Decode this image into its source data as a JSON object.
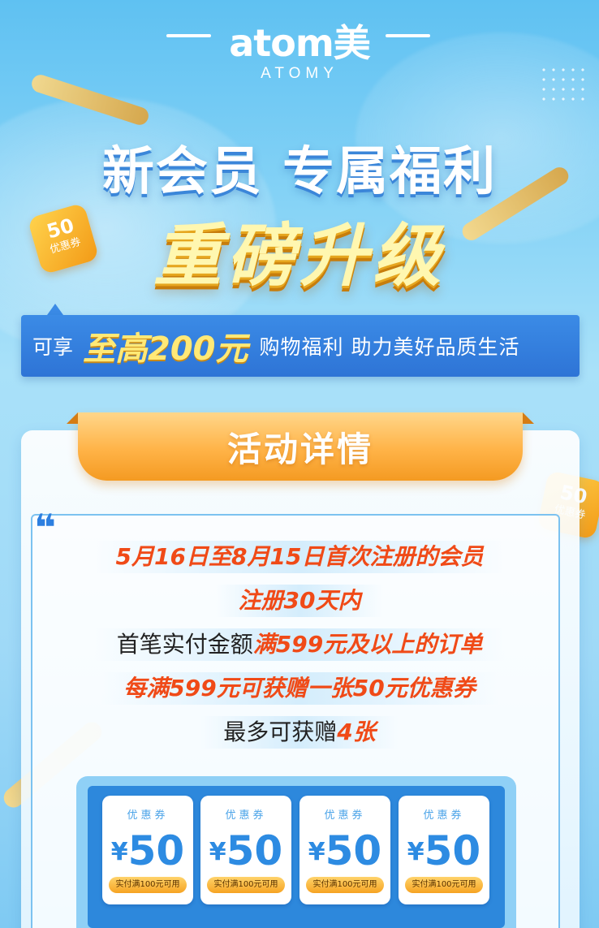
{
  "brand": {
    "logo": "atom美",
    "sub": "ATOMY"
  },
  "headline": {
    "line1": "新会员 专属福利",
    "line2": "重磅升级"
  },
  "stickers": [
    {
      "amount": "50",
      "label": "优惠券"
    },
    {
      "amount": "50",
      "label": "优惠券"
    }
  ],
  "benefit": {
    "prefix": "可享",
    "highlight": "至高200元",
    "suffix": "购物福利 助力美好品质生活"
  },
  "details": {
    "title": "活动详情",
    "quote_mark": "❝",
    "line1": "5月16日至8月15日首次注册的会员",
    "line2": "注册30天内",
    "line3_plain": "首笔实付金额",
    "line3_highlight": "满599元及以上的订单",
    "line4": "每满599元可获赠一张50元优惠券",
    "line5_plain": "最多可获赠",
    "line5_highlight": "4张"
  },
  "coupons": [
    {
      "title": "优惠券",
      "currency": "¥",
      "amount": "50",
      "note": "实付满100元可用"
    },
    {
      "title": "优惠券",
      "currency": "¥",
      "amount": "50",
      "note": "实付满100元可用"
    },
    {
      "title": "优惠券",
      "currency": "¥",
      "amount": "50",
      "note": "实付满100元可用"
    },
    {
      "title": "优惠券",
      "currency": "¥",
      "amount": "50",
      "note": "实付满100元可用"
    }
  ],
  "colors": {
    "accent_blue": "#2d88dc",
    "accent_orange": "#f49a22",
    "highlight_red": "#f04a17",
    "gold_text": "#ffe977"
  }
}
